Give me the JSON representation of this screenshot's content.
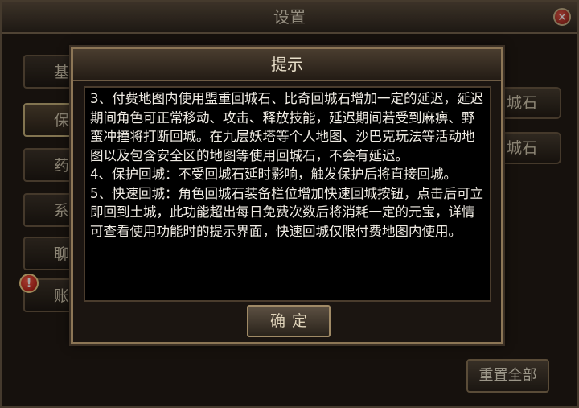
{
  "settings_window": {
    "title": "设置",
    "close_icon": "close-icon",
    "tabs": [
      {
        "label": "基"
      },
      {
        "label": "保"
      },
      {
        "label": "药"
      },
      {
        "label": "系"
      },
      {
        "label": "聊"
      },
      {
        "label": "账"
      }
    ],
    "selected_tab": "保",
    "alert_icon": "exclamation-icon",
    "right_buttons": [
      {
        "label": "城石"
      },
      {
        "label": "城石"
      }
    ],
    "reset_all_label": "重置全部"
  },
  "dialog": {
    "title": "提示",
    "paragraphs": [
      "3、付费地图内使用盟重回城石、比奇回城石增加一定的延迟，延迟期间角色可正常移动、攻击、释放技能，延迟期间若受到麻痹、野蛮冲撞将打断回城。在九层妖塔等个人地图、沙巴克玩法等活动地图以及包含安全区的地图等使用回城石，不会有延迟。",
      "4、保护回城：不受回城石延时影响，触发保护后将直接回城。",
      "5、快速回城：角色回城石装备栏位增加快速回城按钮，点击后可立即回到土城，此功能超出每日免费次数后将消耗一定的元宝，详情可查看使用功能时的提示界面，快速回城仅限付费地图内使用。"
    ],
    "confirm_label": "确定"
  },
  "colors": {
    "panel_bg": "#221b15",
    "border_gold": "#8c7656",
    "text_light": "#f0ece4",
    "alert_red": "#c8180e"
  }
}
